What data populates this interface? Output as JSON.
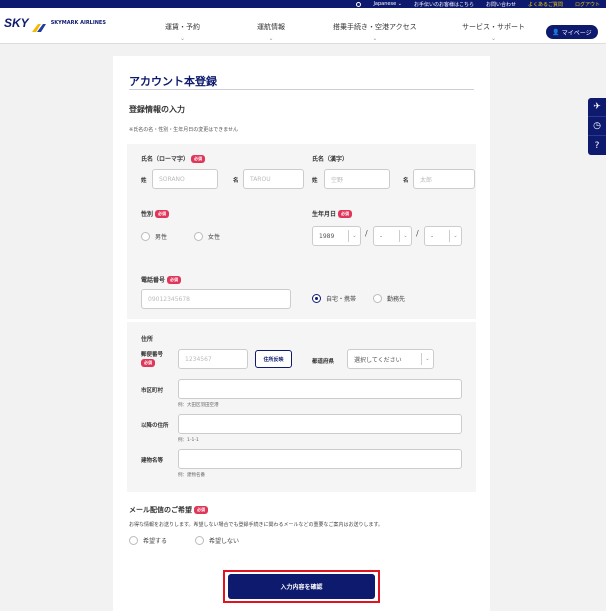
{
  "topbar": {
    "language": "Japanese ⌄",
    "links": [
      "お手伝いのお客様はこちら",
      "お問い合わせ",
      "よくあるご質問",
      "ログアウト"
    ]
  },
  "header": {
    "logo_text": "SKY",
    "airline_text": "SKYMARK AIRLINES",
    "nav": [
      "運賃・予約",
      "運航情報",
      "搭乗手続き・空港アクセス",
      "サービス・サポート"
    ],
    "mypage_label": "マイページ"
  },
  "side_tabs": [
    "✈",
    "◷",
    "?"
  ],
  "form": {
    "page_title": "アカウント本登録",
    "section_title": "登録情報の入力",
    "note": "※氏名の名・性別・生年月日の変更はできません",
    "required_badge": "必須",
    "name_roman": {
      "label": "氏名（ローマ字）",
      "last_label": "姓",
      "last_placeholder": "SORANO",
      "first_label": "名",
      "first_placeholder": "TAROU"
    },
    "name_kanji": {
      "label": "氏名（漢字）",
      "last_label": "姓",
      "last_placeholder": "空野",
      "first_label": "名",
      "first_placeholder": "太郎"
    },
    "gender": {
      "label": "性別",
      "options": [
        "男性",
        "女性"
      ]
    },
    "birthdate": {
      "label": "生年月日",
      "year": "1989",
      "month": "-",
      "day": "-",
      "separator": "/"
    },
    "phone": {
      "label": "電話番号",
      "placeholder": "09012345678",
      "types": [
        "自宅・携帯",
        "勤務先"
      ],
      "selected_type": "自宅・携帯"
    },
    "address": {
      "label": "住所",
      "postal_label": "郵便番号",
      "postal_placeholder": "1234567",
      "lookup_button": "住所反映",
      "prefecture_label": "都道府県",
      "prefecture_value": "選択してください",
      "city_label": "市区町村",
      "city_hint": "例：大田区羽田空港",
      "street_label": "以降の住所",
      "street_hint": "例：1-1-1",
      "building_label": "建物名等",
      "building_hint": "例：建物名番"
    },
    "mail": {
      "label": "メール配信のご希望",
      "description": "お得な情報をお送りします。希望しない場合でも登録手続きに関わるメールなどの重要なご案内はお送りします。",
      "options": [
        "希望する",
        "希望しない"
      ]
    },
    "confirm_button": "入力内容を確認"
  }
}
